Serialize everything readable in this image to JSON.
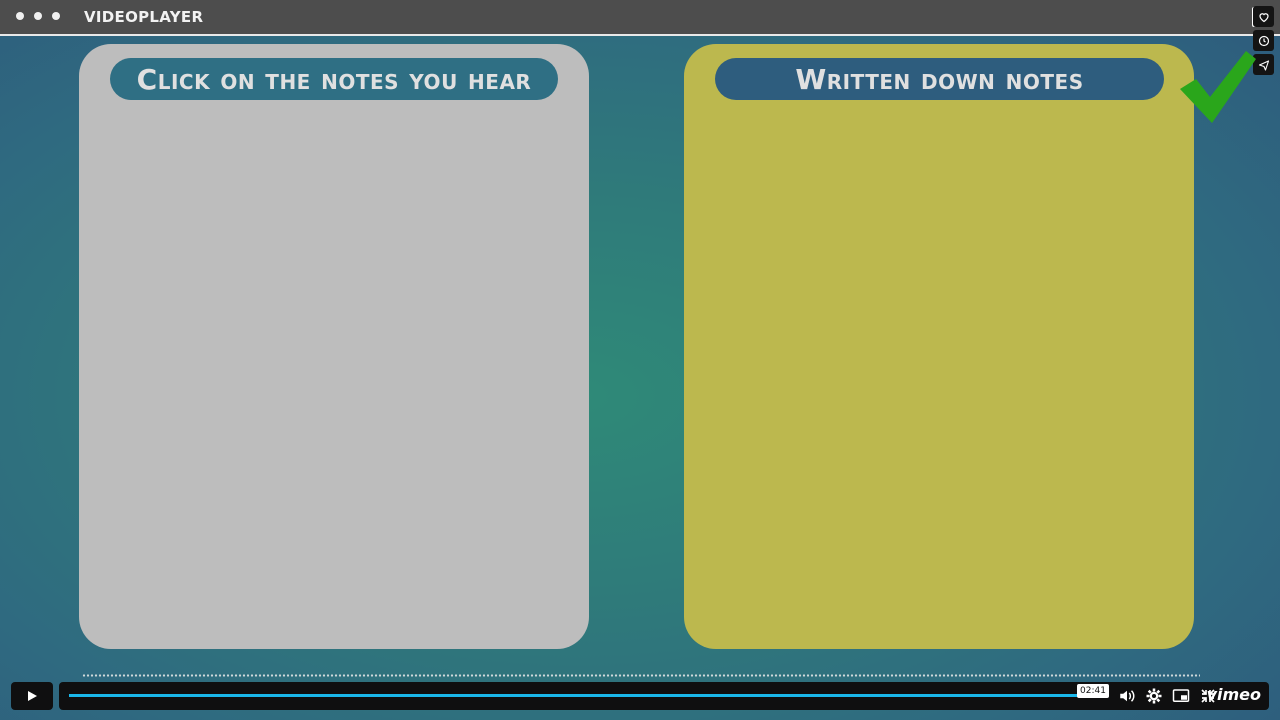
{
  "window": {
    "title": "VIDEOPLAYER"
  },
  "panels": {
    "left": {
      "heading": "Click on the notes you hear"
    },
    "right": {
      "heading": "Written down notes"
    }
  },
  "player": {
    "time_tooltip": "02:41",
    "progress": 0.995,
    "brand": "vimeo",
    "accent_color": "#1ab7ea"
  },
  "side_actions": [
    "heart-icon",
    "clock-icon",
    "send-icon"
  ],
  "colors": {
    "left_panel": "#bdbdbd",
    "right_panel": "#bcb84e",
    "check": "#2aa61b"
  }
}
